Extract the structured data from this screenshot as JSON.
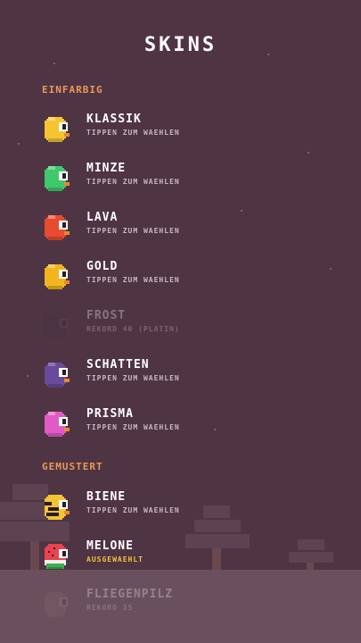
{
  "screen": {
    "title": "SKINS"
  },
  "sections": {
    "solid": "EINFARBIG",
    "patterned": "GEMUSTERT"
  },
  "skins": [
    {
      "name": "KLASSIK",
      "status": "TIPPEN ZUM WAEHLEN",
      "color": "#f5c431",
      "state": "available"
    },
    {
      "name": "MINZE",
      "status": "TIPPEN ZUM WAEHLEN",
      "color": "#3fc86c",
      "state": "available"
    },
    {
      "name": "LAVA",
      "status": "TIPPEN ZUM WAEHLEN",
      "color": "#e84b2f",
      "state": "available"
    },
    {
      "name": "GOLD",
      "status": "TIPPEN ZUM WAEHLEN",
      "color": "#f2b51d",
      "state": "available"
    },
    {
      "name": "FROST",
      "status": "REKORD 40 (PLATIN)",
      "color": "#4a3341",
      "state": "locked"
    },
    {
      "name": "SCHATTEN",
      "status": "TIPPEN ZUM WAEHLEN",
      "color": "#6a4a9a",
      "state": "available"
    },
    {
      "name": "PRISMA",
      "status": "TIPPEN ZUM WAEHLEN",
      "color": "#e05bc5",
      "state": "available"
    },
    {
      "name": "BIENE",
      "status": "TIPPEN ZUM WAEHLEN",
      "color": "#f5c431",
      "state": "available"
    },
    {
      "name": "MELONE",
      "status": "AUSGEWAEHLT",
      "color": "#e9434f",
      "state": "selected"
    },
    {
      "name": "FLIEGENPILZ",
      "status": "REKORD 35",
      "color": "#7a5c68",
      "state": "locked"
    }
  ],
  "colors": {
    "background": "#4f3444",
    "section_header": "#e89a56",
    "selected_status": "#f2c53d"
  }
}
